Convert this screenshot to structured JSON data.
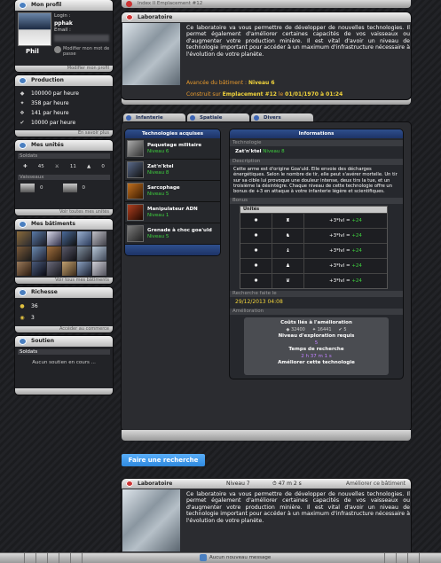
{
  "top_header": {
    "label": "Index II Emplacement #12"
  },
  "profile": {
    "title": "Mon profil",
    "login_label": "Login :",
    "login_value": "pphak",
    "email_label": "Email :",
    "username": "Phil",
    "change_password": "Modifier mon mot de passe",
    "edit_profile": "Modifier mon profil"
  },
  "production": {
    "title": "Production",
    "rows": [
      "100000 par heure",
      "358 par heure",
      "141 par heure",
      "10000 par heure"
    ],
    "footer": "En savoir plus"
  },
  "units": {
    "title": "Mes unités",
    "soldiers_label": "Soldats",
    "soldiers": [
      "45",
      "11",
      "0"
    ],
    "vessels_label": "Vaisseaux",
    "vessels": [
      "0",
      "0"
    ],
    "footer": "Voir toutes mes unités"
  },
  "buildings": {
    "title": "Mes bâtiments",
    "footer": "Voir tous mes bâtiments"
  },
  "wealth": {
    "title": "Richesse",
    "rows": [
      "36",
      "3"
    ],
    "footer": "Accéder au commerce"
  },
  "support": {
    "title": "Soutien",
    "soldiers_label": "Soldats",
    "empty": "Aucun soutien en cours ..."
  },
  "lab": {
    "title": "Laboratoire",
    "description": "Ce laboratoire va vous permettre de développer de nouvelles technologies. Il permet également d'améliorer certaines capacités de vos vaisseaux ou d'augmenter votre production minière. Il est vital d'avoir un niveau de technologie important pour accéder à un maximum d'infrastructure nécessaire à l'évolution de votre planète.",
    "advance_label": "Avancée du bâtiment :",
    "advance_value": "Niveau 6",
    "built_label": "Construit sur",
    "built_value": "Emplacement #12",
    "built_on": "le",
    "built_date": "01/01/1970 à 01:24"
  },
  "tabs": [
    {
      "label": "Infanterie"
    },
    {
      "label": "Spatiale"
    },
    {
      "label": "Divers"
    }
  ],
  "tech_list": {
    "header": "Technologies acquises",
    "items": [
      {
        "name": "Paquetage militaire",
        "level": "Niveau 6"
      },
      {
        "name": "Zat'n'ktel",
        "level": "Niveau 8"
      },
      {
        "name": "Sarcophage",
        "level": "Niveau 5"
      },
      {
        "name": "Manipulateur ADN",
        "level": "Niveau 1"
      },
      {
        "name": "Grenade à choc goa'uld",
        "level": "Niveau 5"
      }
    ]
  },
  "info": {
    "header": "Informations",
    "tech_label": "Technologie",
    "tech_name": "Zat'n'ktel",
    "tech_level": "Niveau 8",
    "desc_label": "Description",
    "description": "Cette arme est d'origine Goa'uld. Elle envoie des décharges énergétiques. Selon le nombre de tir, elle peut s'avérer mortelle. Un tir sur sa cible lui provoque une douleur intense, deux tirs la tue, et un troisième la désintègre. Chaque niveau de cette technologie offre un bonus de +3 en attaque à votre infanterie légère et scientifiques.",
    "bonus_label": "Bonus",
    "units_label": "Unités",
    "bonus_text": "+3*lvl =",
    "bonus_value": "+24",
    "research_label": "Recherche faite le",
    "research_date": "29/12/2013 04:08",
    "improve_label": "Amélioration",
    "cost_title": "Coûts liés à l'amélioration",
    "cost_res1": "32400",
    "cost_res2": "16441",
    "cost_res3": "5",
    "explore_label": "Niveau d'exploration requis",
    "explore_value": "5",
    "time_label": "Temps de recherche",
    "time_value": "2 h 37 m 1 s",
    "improve_btn": "Améliorer cette technologie"
  },
  "search_button": "Faire une recherche",
  "lab2": {
    "title": "Laboratoire",
    "level": "Niveau 7",
    "time": "47 m 2 s",
    "improve": "Améliorer ce bâtiment",
    "description": "Ce laboratoire va vous permettre de développer de nouvelles technologies. Il permet également d'améliorer certaines capacités de vos vaisseaux ou d'augmenter votre production minière. Il est vital d'avoir un niveau de technologie important pour accéder à un maximum d'infrastructure nécessaire à l'évolution de votre planète."
  },
  "bottom_bar": {
    "new_message": "Aucun nouveau message"
  }
}
